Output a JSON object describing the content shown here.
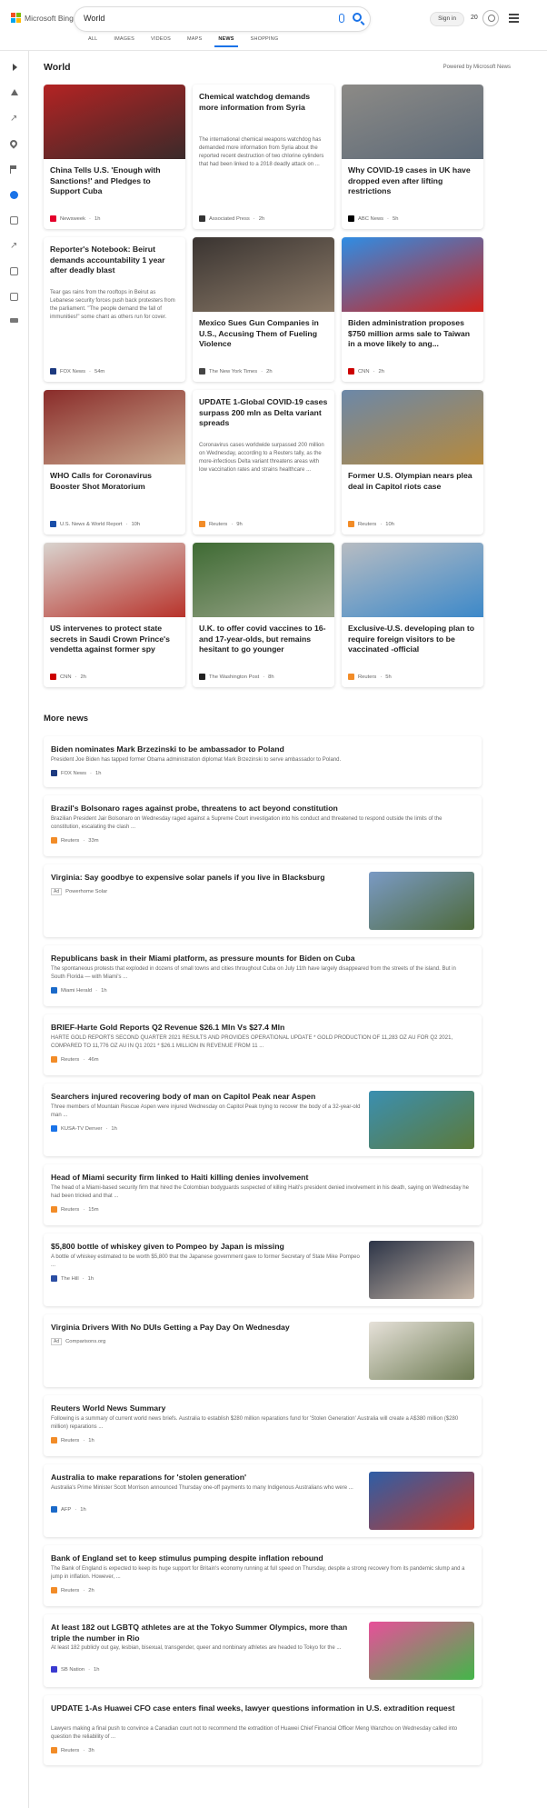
{
  "header": {
    "logo_text": "Microsoft Bing",
    "search_value": "World",
    "signin_label": "Sign in",
    "rewards_count": "20",
    "tabs": [
      {
        "label": "ALL"
      },
      {
        "label": "IMAGES"
      },
      {
        "label": "VIDEOS"
      },
      {
        "label": "MAPS"
      },
      {
        "label": "NEWS"
      },
      {
        "label": "SHOPPING"
      }
    ],
    "active_tab": "NEWS"
  },
  "sidebar": {
    "icons": [
      "expand-arrow-icon",
      "home-icon",
      "expand-x-icon",
      "location-pin-icon",
      "flag-icon",
      "globe-icon",
      "science-icon",
      "rocket-icon",
      "image-icon",
      "building-icon",
      "money-icon"
    ]
  },
  "main": {
    "section_title": "World",
    "powered_by": "Powered by Microsoft News",
    "top_cards": [
      {
        "title": "China Tells U.S. 'Enough with Sanctions!' and Pledges to Support Cuba",
        "desc": "",
        "source": "Newsweek",
        "time": "1h",
        "src_color": "#e4002b",
        "img_colors": [
          "#b32323",
          "#3b2a2a"
        ]
      },
      {
        "title": "Chemical watchdog demands more information from Syria",
        "desc": "The international chemical weapons watchdog has demanded more information from Syria about the reported recent destruction of two chlorine cylinders that had been linked to a 2018 deadly attack on ...",
        "source": "Associated Press",
        "time": "2h",
        "src_color": "#333333",
        "img_colors": []
      },
      {
        "title": "Why COVID-19 cases in UK have dropped even after lifting restrictions",
        "desc": "",
        "source": "ABC News",
        "time": "5h",
        "src_color": "#000000",
        "img_colors": [
          "#8c8a86",
          "#5d6a78"
        ]
      },
      {
        "title": "Reporter's Notebook: Beirut demands accountability 1 year after deadly blast",
        "desc": "Tear gas rains from the rooftops in Beirut as Lebanese security forces push back protesters from the parliament. \"The people demand the fall of immunities!\" some chant as others run for cover.",
        "source": "FOX News",
        "time": "54m",
        "src_color": "#1d3a80",
        "img_colors": []
      },
      {
        "title": "Mexico Sues Gun Companies in U.S., Accusing Them of Fueling Violence",
        "desc": "",
        "source": "The New York Times",
        "time": "2h",
        "src_color": "#444444",
        "img_colors": [
          "#3a3431",
          "#8b7a68"
        ]
      },
      {
        "title": "Biden administration proposes $750 million arms sale to Taiwan in a move likely to ang...",
        "desc": "",
        "source": "CNN",
        "time": "2h",
        "src_color": "#cc0000",
        "img_colors": [
          "#2f8de4",
          "#d0221b"
        ]
      },
      {
        "title": "WHO Calls for Coronavirus Booster Shot Moratorium",
        "desc": "",
        "source": "U.S. News & World Report",
        "time": "10h",
        "src_color": "#1a4ea8",
        "img_colors": [
          "#8a2c2a",
          "#c9a98e"
        ]
      },
      {
        "title": "UPDATE 1-Global COVID-19 cases surpass 200 mln as Delta variant spreads",
        "desc": "Coronavirus cases worldwide surpassed 200 million on Wednesday, according to a Reuters tally, as the more-infectious Delta variant threatens areas with low vaccination rates and strains healthcare ...",
        "source": "Reuters",
        "time": "9h",
        "src_color": "#f28c28",
        "img_colors": []
      },
      {
        "title": "Former U.S. Olympian nears plea deal in Capitol riots case",
        "desc": "",
        "source": "Reuters",
        "time": "10h",
        "src_color": "#f28c28",
        "img_colors": [
          "#6c88a8",
          "#b6893c"
        ]
      },
      {
        "title": "US intervenes to protect state secrets in Saudi Crown Prince's vendetta against former spy",
        "desc": "",
        "source": "CNN",
        "time": "2h",
        "src_color": "#cc0000",
        "img_colors": [
          "#d9d4cf",
          "#b8332b"
        ]
      },
      {
        "title": "U.K. to offer covid vaccines to 16- and 17-year-olds, but remains hesitant to go younger",
        "desc": "",
        "source": "The Washington Post",
        "time": "8h",
        "src_color": "#222222",
        "img_colors": [
          "#3f6b34",
          "#9aa58a"
        ]
      },
      {
        "title": "Exclusive-U.S. developing plan to require foreign visitors to be vaccinated -official",
        "desc": "",
        "source": "Reuters",
        "time": "5h",
        "src_color": "#f28c28",
        "img_colors": [
          "#b7bcc2",
          "#3d89c9"
        ]
      }
    ],
    "more_news_title": "More news",
    "more_news": [
      {
        "title": "Biden nominates Mark Brzezinski to be ambassador to Poland",
        "desc": "President Joe Biden has tapped former Obama administration diplomat Mark Brzezinski to serve ambassador to Poland.",
        "source": "FOX News",
        "time": "1h",
        "ad": "",
        "src_color": "#1d3a80",
        "img_colors": []
      },
      {
        "title": "Brazil's Bolsonaro rages against probe, threatens to act beyond constitution",
        "desc": "Brazilian President Jair Bolsonaro on Wednesday raged against a Supreme Court investigation into his conduct and threatened to respond outside the limits of the constitution, escalating the clash ...",
        "source": "Reuters",
        "time": "33m",
        "ad": "",
        "src_color": "#f28c28",
        "img_colors": []
      },
      {
        "title": "Virginia: Say goodbye to expensive solar panels if you live in Blacksburg",
        "desc": "",
        "source": "Powerhome Solar",
        "time": "",
        "ad": "Ad",
        "src_color": "",
        "img_colors": [
          "#7a9ac4",
          "#4e6a3b"
        ]
      },
      {
        "title": "Republicans bask in their Miami platform, as pressure mounts for Biden on Cuba",
        "desc": "The spontaneous protests that exploded in dozens of small towns and cities throughout Cuba on July 11th have largely disappeared from the streets of the island. But in South Florida — with Miami's ...",
        "source": "Miami Herald",
        "time": "1h",
        "ad": "",
        "src_color": "#1b6ac9",
        "img_colors": []
      },
      {
        "title": "BRIEF-Harte Gold Reports Q2 Revenue $26.1 Mln Vs $27.4 Mln",
        "desc": "HARTE GOLD REPORTS SECOND QUARTER 2021 RESULTS AND PROVIDES OPERATIONAL UPDATE * GOLD PRODUCTION OF 11,283 OZ AU FOR Q2 2021, COMPARED TO 11,776 OZ AU IN Q1 2021 * $26.1 MILLION IN REVENUE FROM 11 ...",
        "source": "Reuters",
        "time": "46m",
        "ad": "",
        "src_color": "#f28c28",
        "img_colors": []
      },
      {
        "title": "Searchers injured recovering body of man on Capitol Peak near Aspen",
        "desc": "Three members of Mountain Rescue Aspen were injured Wednesday on Capitol Peak trying to recover the body of a 32-year-old man ...",
        "source": "KUSA-TV Denver",
        "time": "1h",
        "ad": "",
        "src_color": "#1a73e8",
        "img_colors": [
          "#3b8fb0",
          "#5c7a3a"
        ]
      },
      {
        "title": "Head of Miami security firm linked to Haiti killing denies involvement",
        "desc": "The head of a Miami-based security firm that hired the Colombian bodyguards suspected of killing Haiti's president denied involvement in his death, saying on Wednesday he had been tricked and that ...",
        "source": "Reuters",
        "time": "15m",
        "ad": "",
        "src_color": "#f28c28",
        "img_colors": []
      },
      {
        "title": "$5,800 bottle of whiskey given to Pompeo by Japan is missing",
        "desc": "A bottle of whiskey estimated to be worth $5,800 that the Japanese government gave to former Secretary of State Mike Pompeo ...",
        "source": "The Hill",
        "time": "1h",
        "ad": "",
        "src_color": "#2b4ea3",
        "img_colors": [
          "#2d3548",
          "#c8b8a8"
        ]
      },
      {
        "title": "Virginia Drivers With No DUIs Getting a Pay Day On Wednesday",
        "desc": "",
        "source": "Comparisons.org",
        "time": "",
        "ad": "Ad",
        "src_color": "",
        "img_colors": [
          "#e6e1d9",
          "#6d7b52"
        ]
      },
      {
        "title": "Reuters World News Summary",
        "desc": "Following is a summary of current world news briefs. Australia to establish $280 million reparations fund for 'Stolen Generation' Australia will create a A$380 million ($280 million) reparations ...",
        "source": "Reuters",
        "time": "1h",
        "ad": "",
        "src_color": "#f28c28",
        "img_colors": []
      },
      {
        "title": "Australia to make reparations for 'stolen generation'",
        "desc": "Australia's Prime Minister Scott Morrison announced Thursday one-off payments to many Indigenous Australians who were ...",
        "source": "AFP",
        "time": "1h",
        "ad": "",
        "src_color": "#1b6ac9",
        "img_colors": [
          "#2e5ea6",
          "#c0392b"
        ]
      },
      {
        "title": "Bank of England set to keep stimulus pumping despite inflation rebound",
        "desc": "The Bank of England is expected to keep its huge support for Britain's economy running at full speed on Thursday, despite a strong recovery from its pandemic slump and a jump in inflation. However, ...",
        "source": "Reuters",
        "time": "2h",
        "ad": "",
        "src_color": "#f28c28",
        "img_colors": []
      },
      {
        "title": "At least 182 out LGBTQ athletes are at the Tokyo Summer Olympics, more than triple the number in Rio",
        "desc": "At least 182 publicly out gay, lesbian, bisexual, transgender, queer and nonbinary athletes are headed to Tokyo for the ...",
        "source": "SB Nation",
        "time": "1h",
        "ad": "",
        "src_color": "#3a3ad0",
        "img_colors": [
          "#e84f9a",
          "#43b649"
        ]
      },
      {
        "title": "UPDATE 1-As Huawei CFO case enters final weeks, lawyer questions information in U.S. extradition request",
        "desc": "Lawyers making a final push to convince a Canadian court not to recommend the extradition of Huawei Chief Financial Officer Meng Wanzhou on Wednesday called into question the reliability of ...",
        "source": "Reuters",
        "time": "3h",
        "ad": "",
        "src_color": "#f28c28",
        "img_colors": []
      }
    ]
  },
  "colors": {
    "accent": "#1a73e8",
    "bing_red": "#f25022",
    "bing_green": "#7fba00",
    "bing_blue": "#00a4ef",
    "bing_yellow": "#ffb900"
  }
}
